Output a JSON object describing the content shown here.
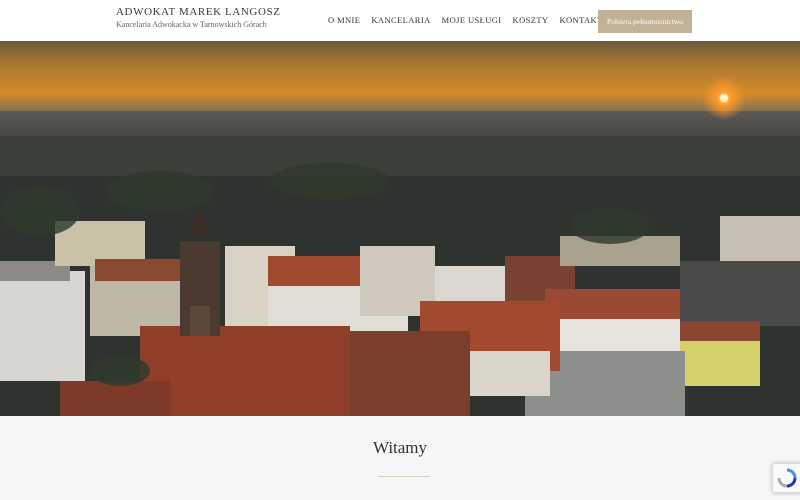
{
  "header": {
    "brand_title": "ADWOKAT MAREK LANGOSZ",
    "brand_subtitle": "Kancelaria Adwokacka w Tarnowskich Górach",
    "nav": [
      "O MNIE",
      "KANCELARIA",
      "MOJE USŁUGI",
      "KOSZTY",
      "KONTAKT"
    ],
    "cta_label": "Połsiera pełnomocnictwo"
  },
  "hero": {
    "image": "aerial-town-sunrise"
  },
  "welcome": {
    "title": "Witamy"
  },
  "colors": {
    "accent": "#c2b295",
    "header_bg": "#ffffff",
    "section_bg": "#f6f6f6"
  }
}
